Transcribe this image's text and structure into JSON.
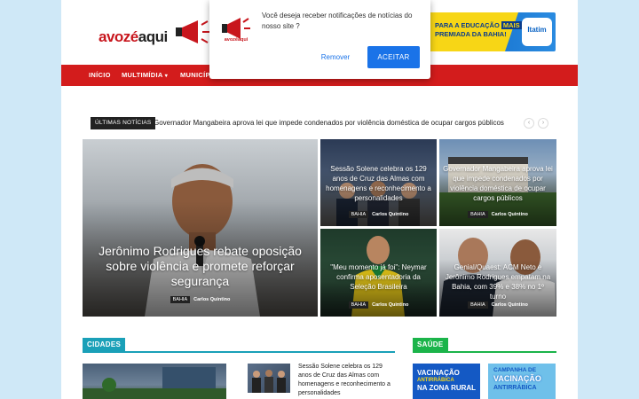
{
  "logo": {
    "text_a": "avozé",
    "text_b": "aqui"
  },
  "ad": {
    "line1": "PARA A EDUCAÇÃO",
    "highlight": "MAIS",
    "line2": "PREMIADA DA BAHIA!",
    "brand": "Itatim"
  },
  "nav": {
    "items": [
      "INÍCIO",
      "MULTIMÍDIA",
      "MUNICÍP"
    ]
  },
  "notification": {
    "icon_label": "avozéaqui",
    "message": "Você deseja receber notificações de notícias do nosso site ?",
    "remover": "Remover",
    "aceitar": "ACEITAR"
  },
  "ticker": {
    "badge": "ÚLTIMAS NOTÍCIAS",
    "headline": "Governador Mangabeira aprova lei que impede condenados por violência doméstica de ocupar cargos públicos",
    "prev": "‹",
    "next": "›"
  },
  "featured": [
    {
      "title": "Jerônimo Rodrigues rebate oposição sobre violência e promete reforçar segurança",
      "category": "BAHIA",
      "author": "Carlos Quintino"
    },
    {
      "title": "Sessão Solene celebra os 129 anos de Cruz das Almas com homenagens e reconhecimento a personalidades",
      "category": "BAHIA",
      "author": "Carlos Quintino"
    },
    {
      "title": "Governador Mangabeira aprova lei que impede condenados por violência doméstica de ocupar cargos públicos",
      "category": "BAHIA",
      "author": "Carlos Quintino"
    },
    {
      "title": "\"Meu momento já foi\": Neymar confirma aposentadoria da Seleção Brasileira",
      "category": "BAHIA",
      "author": "Carlos Quintino"
    },
    {
      "title": "Genial/Quaest: ACM Neto e Jerônimo Rodrigues empatam na Bahia, com 39% e 38% no 1º turno",
      "category": "BAHIA",
      "author": "Carlos Quintino"
    }
  ],
  "sections": {
    "cidades": "CIDADES",
    "saude": "SAÚDE"
  },
  "cidades_list": {
    "item1": "Sessão Solene celebra os 129 anos de Cruz das Almas com homenagens e reconhecimento a personalidades"
  },
  "saude_cards": [
    {
      "line1": "VACINAÇÃO",
      "line2": "ANTIRRÁBICA",
      "line3": "NA ZONA RURAL"
    },
    {
      "line1": "CAMPANHA DE",
      "line2": "VACINAÇÃO",
      "line3": "ANTIRRÁBICA"
    }
  ],
  "colors": {
    "brand_red": "#d31c1c",
    "cidades": "#1aa0b8",
    "saude": "#1bb44a",
    "notif_button": "#1a73e8"
  }
}
